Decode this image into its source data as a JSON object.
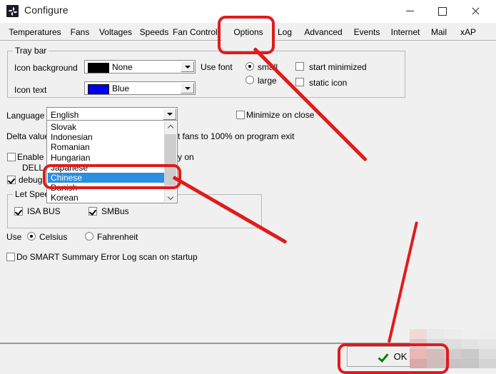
{
  "window": {
    "title": "Configure",
    "icon": "fan-icon",
    "controls": {
      "minimize": "minimize-icon",
      "maximize": "maximize-icon",
      "close": "close-icon"
    }
  },
  "tabs": [
    {
      "label": "Temperatures",
      "selected": false
    },
    {
      "label": "Fans",
      "selected": false
    },
    {
      "label": "Voltages",
      "selected": false
    },
    {
      "label": "Speeds",
      "selected": false
    },
    {
      "label": "Fan Control",
      "selected": false
    },
    {
      "label": "Options",
      "selected": true
    },
    {
      "label": "Log",
      "selected": false
    },
    {
      "label": "Advanced",
      "selected": false
    },
    {
      "label": "Events",
      "selected": false
    },
    {
      "label": "Internet",
      "selected": false
    },
    {
      "label": "Mail",
      "selected": false
    },
    {
      "label": "xAP",
      "selected": false
    }
  ],
  "tray_bar": {
    "title": "Tray bar",
    "icon_background_label": "Icon background",
    "icon_background_value": "None",
    "icon_background_color": "#000000",
    "icon_text_label": "Icon text",
    "icon_text_value": "Blue",
    "icon_text_color": "#0000ee",
    "use_font_label": "Use font",
    "font_small": "small",
    "font_large": "large",
    "font_selected": "small",
    "start_minimized": "start minimized",
    "start_minimized_checked": false,
    "static_icon": "static icon",
    "static_icon_checked": false
  },
  "options": {
    "language_label": "Language",
    "language_value": "English",
    "minimize_on_close": "Minimize on close",
    "minimize_on_close_checked": false,
    "delta_value_label": "Delta value",
    "fans_100_text": "t fans to 100% on program exit",
    "enable_label": "Enable",
    "enable_checked": false,
    "dell_label": "DELL",
    "only_on_text": "y on",
    "debug_label": "debug",
    "debug_checked": true,
    "let_speed_title": "Let Spee",
    "isa_bus": "ISA BUS",
    "isa_bus_checked": true,
    "smbus": "SMBus",
    "smbus_checked": true,
    "use_label": "Use",
    "celsius": "Celsius",
    "fahrenheit": "Fahrenheit",
    "temp_unit_selected": "Celsius",
    "smart_scan": "Do SMART Summary Error Log scan on startup",
    "smart_scan_checked": false
  },
  "language_dropdown": {
    "open": true,
    "selected": "Chinese",
    "items": [
      "Slovak",
      "Indonesian",
      "Romanian",
      "Hungarian",
      "Japanese",
      "Chinese",
      "Danish",
      "Korean"
    ],
    "scroll_up_icon": "chevron-up-icon",
    "scroll_down_icon": "chevron-down-icon"
  },
  "footer": {
    "ok_label": "OK",
    "ok_icon": "green-check-icon"
  },
  "annotations": {
    "color": "#e01b1b",
    "shapes": [
      {
        "kind": "oval",
        "name": "options-tab-highlight"
      },
      {
        "kind": "oval",
        "name": "chinese-item-highlight"
      },
      {
        "kind": "oval",
        "name": "ok-button-highlight"
      },
      {
        "kind": "line",
        "name": "arrow-options-to-dropdown"
      },
      {
        "kind": "line",
        "name": "arrow-dropdown-to-ok"
      },
      {
        "kind": "line",
        "name": "arrow-to-ok-button"
      }
    ]
  }
}
